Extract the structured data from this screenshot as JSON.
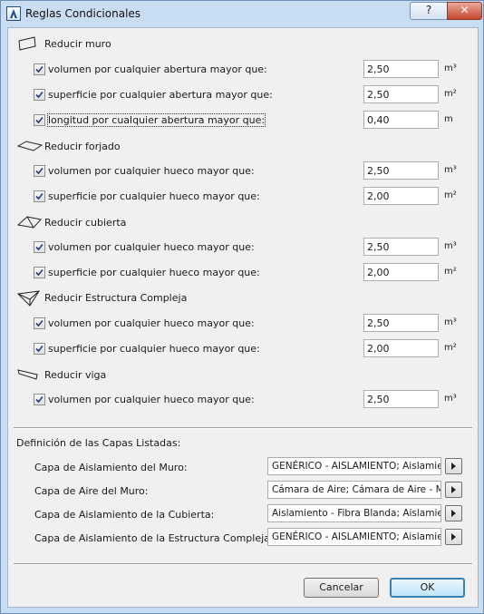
{
  "window": {
    "title": "Reglas Condicionales",
    "help_label": "?",
    "close_label": "✕"
  },
  "groups": [
    {
      "label": "Reducir muro",
      "icon": "wall-icon",
      "rows": [
        {
          "label": "volumen por cualquier abertura mayor que:",
          "value": "2,50",
          "unit": "m³",
          "checked": true
        },
        {
          "label": "superficie por cualquier abertura mayor que:",
          "value": "2,50",
          "unit": "m²",
          "checked": true
        },
        {
          "label": "longitud por cualquier abertura mayor que:",
          "value": "0,40",
          "unit": "m",
          "checked": true
        }
      ]
    },
    {
      "label": "Reducir forjado",
      "icon": "slab-icon",
      "rows": [
        {
          "label": "volumen por cualquier hueco mayor que:",
          "value": "2,50",
          "unit": "m³",
          "checked": true
        },
        {
          "label": "superficie por cualquier hueco mayor que:",
          "value": "2,00",
          "unit": "m²",
          "checked": true
        }
      ]
    },
    {
      "label": "Reducir cubierta",
      "icon": "roof-icon",
      "rows": [
        {
          "label": "volumen por cualquier hueco mayor que:",
          "value": "2,50",
          "unit": "m³",
          "checked": true
        },
        {
          "label": "superficie por cualquier hueco mayor que:",
          "value": "2,00",
          "unit": "m²",
          "checked": true
        }
      ]
    },
    {
      "label": "Reducir Estructura Compleja",
      "icon": "complex-structure-icon",
      "rows": [
        {
          "label": "volumen por cualquier hueco mayor que:",
          "value": "2,50",
          "unit": "m³",
          "checked": true
        },
        {
          "label": "superficie por cualquier hueco mayor que:",
          "value": "2,00",
          "unit": "m²",
          "checked": true
        }
      ]
    },
    {
      "label": "Reducir viga",
      "icon": "beam-icon",
      "rows": [
        {
          "label": "volumen por cualquier hueco mayor que:",
          "value": "2,50",
          "unit": "m³",
          "checked": true
        }
      ]
    }
  ],
  "layers": {
    "title": "Definición de las Capas Listadas:",
    "items": [
      {
        "label": "Capa de Aislamiento del Muro:",
        "value": "GENÉRICO - AISLAMIENTO; Aislamie"
      },
      {
        "label": "Capa de Aire del Muro:",
        "value": "Cámara de Aire; Cámara de Aire - Ma"
      },
      {
        "label": "Capa de Aislamiento de la Cubierta:",
        "value": "Aislamiento - Fibra Blanda; Aislamie"
      },
      {
        "label": "Capa de Aislamiento de la Estructura Compleja:",
        "value": "GENÉRICO - AISLAMIENTO; Aislamie"
      }
    ]
  },
  "buttons": {
    "cancel": "Cancelar",
    "ok": "OK"
  }
}
